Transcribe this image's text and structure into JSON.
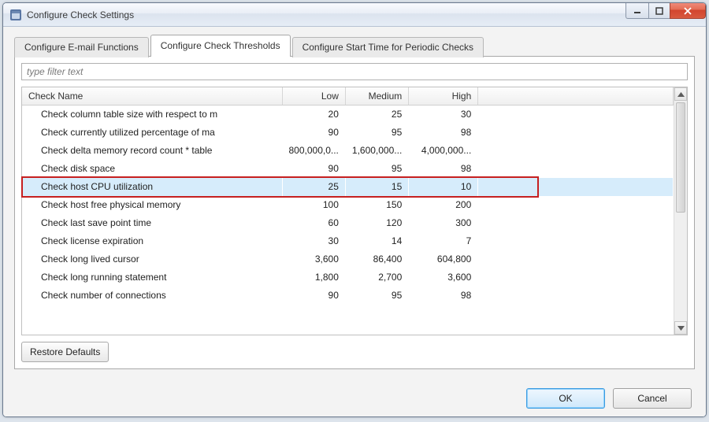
{
  "window": {
    "title": "Configure Check Settings"
  },
  "tabs": [
    {
      "label": "Configure E-mail Functions",
      "active": false
    },
    {
      "label": "Configure Check Thresholds",
      "active": true
    },
    {
      "label": "Configure Start Time for Periodic Checks",
      "active": false
    }
  ],
  "filter": {
    "placeholder": "type filter text",
    "value": ""
  },
  "columns": {
    "name": "Check Name",
    "low": "Low",
    "medium": "Medium",
    "high": "High"
  },
  "rows": [
    {
      "name": "Check column table size with respect to m",
      "low": "20",
      "medium": "25",
      "high": "30",
      "selected": false
    },
    {
      "name": "Check currently utilized percentage of ma",
      "low": "90",
      "medium": "95",
      "high": "98",
      "selected": false
    },
    {
      "name": "Check delta memory record count * table",
      "low": "800,000,0...",
      "medium": "1,600,000...",
      "high": "4,000,000...",
      "selected": false
    },
    {
      "name": "Check disk space",
      "low": "90",
      "medium": "95",
      "high": "98",
      "selected": false
    },
    {
      "name": "Check host CPU utilization",
      "low": "25",
      "medium": "15",
      "high": "10",
      "selected": true,
      "highlight": true
    },
    {
      "name": "Check host free physical memory",
      "low": "100",
      "medium": "150",
      "high": "200",
      "selected": false
    },
    {
      "name": "Check last save point time",
      "low": "60",
      "medium": "120",
      "high": "300",
      "selected": false
    },
    {
      "name": "Check license expiration",
      "low": "30",
      "medium": "14",
      "high": "7",
      "selected": false
    },
    {
      "name": "Check long lived cursor",
      "low": "3,600",
      "medium": "86,400",
      "high": "604,800",
      "selected": false
    },
    {
      "name": "Check long running statement",
      "low": "1,800",
      "medium": "2,700",
      "high": "3,600",
      "selected": false
    },
    {
      "name": "Check number of connections",
      "low": "90",
      "medium": "95",
      "high": "98",
      "selected": false
    }
  ],
  "buttons": {
    "restore_defaults": "Restore Defaults",
    "ok": "OK",
    "cancel": "Cancel"
  }
}
